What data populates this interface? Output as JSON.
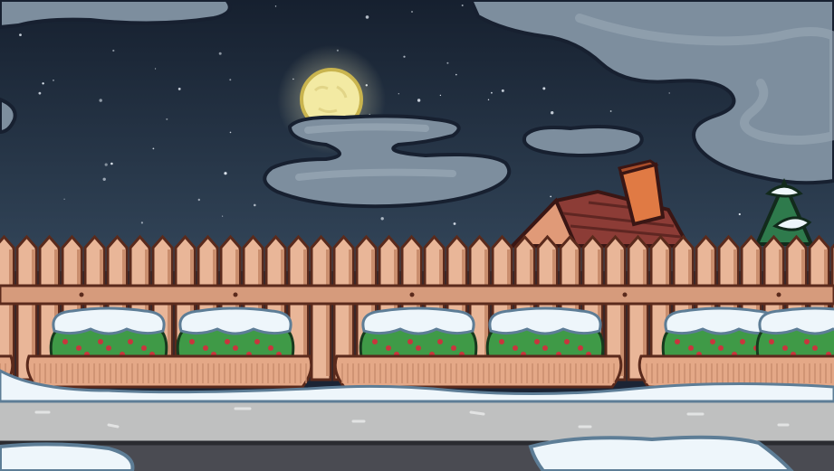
{
  "scene": {
    "title": "",
    "time_of_day": "night",
    "weather": "snow",
    "colors": {
      "sky_top": "#16202f",
      "sky_bottom": "#33465a",
      "moon": "#f3eaa3",
      "cloud": "#7d8e9e",
      "cloud_light": "#9aa9b6",
      "fence": "#e9b698",
      "fence_shadow": "#c98d6d",
      "fence_outline": "#5a2a1c",
      "roof": "#8c3c36",
      "chimney": "#e07a44",
      "hedge": "#3f9a47",
      "berry": "#c9353d",
      "snow": "#eef6fb",
      "snow_shade": "#bcd8ea",
      "planter": "#e4a887",
      "sidewalk": "#bfc0c0",
      "road": "#4a4b52"
    },
    "icons": [
      "moon",
      "cloud",
      "house-roof",
      "chimney",
      "pine-tree",
      "picket-fence",
      "snowy-hedge",
      "planter-box",
      "sidewalk",
      "road"
    ]
  }
}
